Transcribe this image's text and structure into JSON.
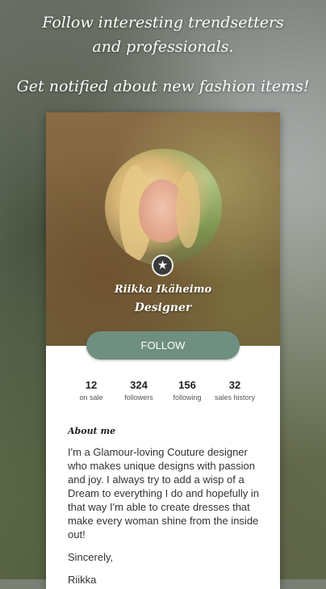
{
  "headline": {
    "line1": "Follow interesting trendsetters and professionals.",
    "line2": "Get notified about new fashion items!"
  },
  "profile": {
    "name": "Riikka Ikäheimo",
    "role": "Designer",
    "badge_icon": "star-icon",
    "follow_label": "FOLLOW",
    "follow_color": "#6f8f80"
  },
  "stats": [
    {
      "value": "12",
      "label": "on sale"
    },
    {
      "value": "324",
      "label": "followers"
    },
    {
      "value": "156",
      "label": "following"
    },
    {
      "value": "32",
      "label": "sales history"
    }
  ],
  "about": {
    "title": "About me",
    "text": "I'm a Glamour-loving Couture designer who makes unique designs with passion and joy. I always try to add a wisp of a Dream to everything I do and hopefully in that way I'm able to create dresses that make every woman shine from the inside out!",
    "sign_off": "Sincerely,",
    "signature": "Riikka"
  }
}
